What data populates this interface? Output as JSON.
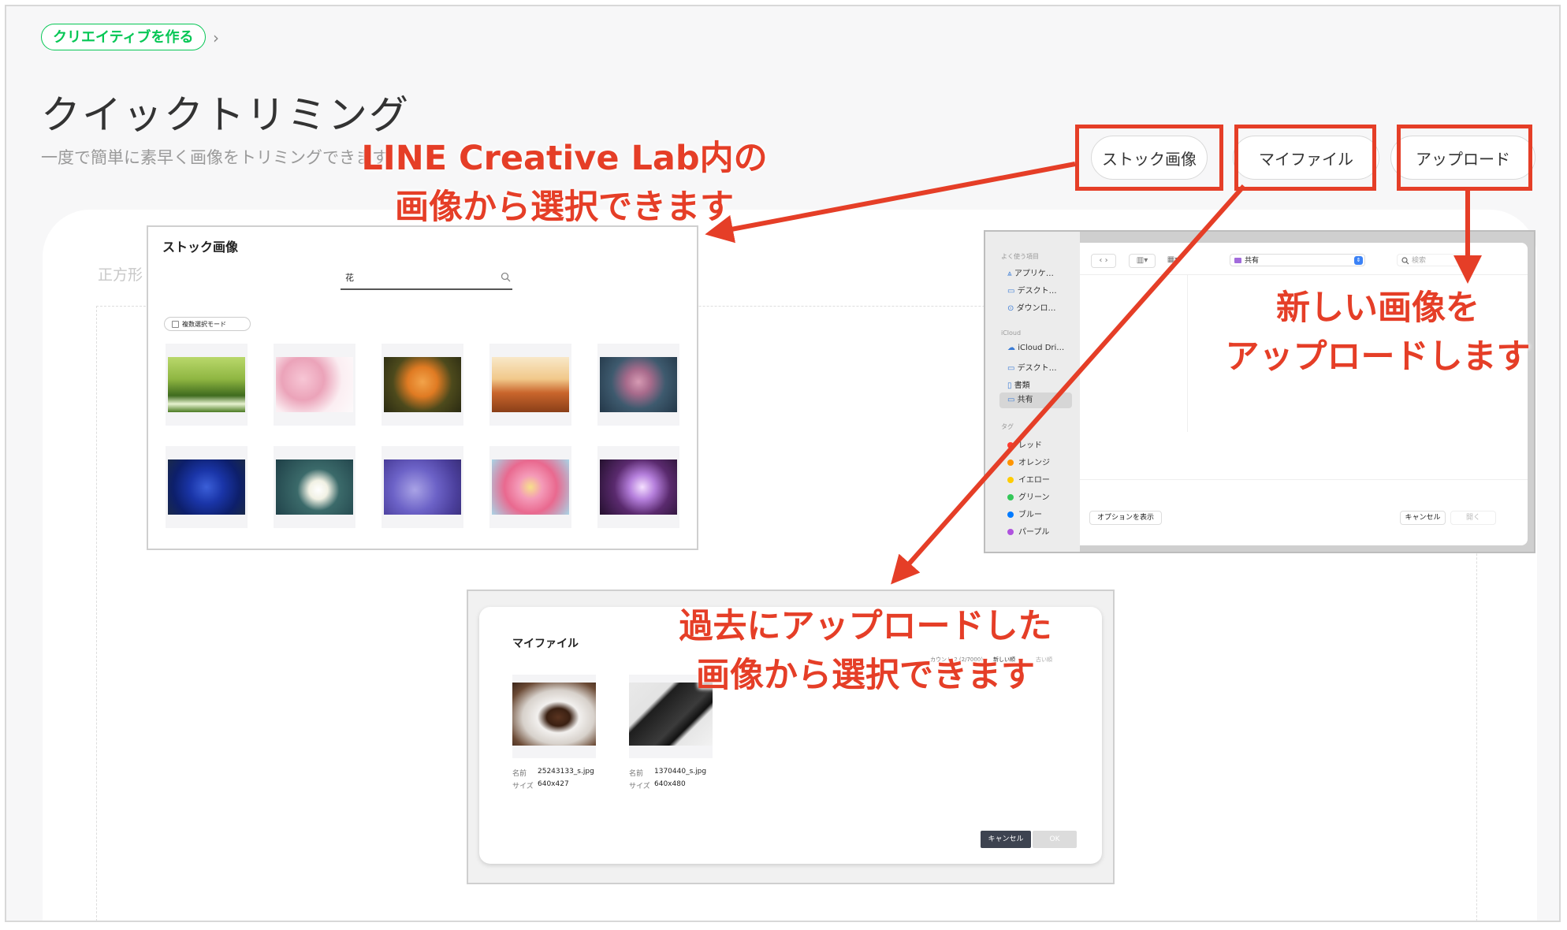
{
  "breadcrumb": {
    "label": "クリエイティブを作る",
    "chevron": "›"
  },
  "page": {
    "title": "クイックトリミング",
    "description": "一度で簡単に素早く画像をトリミングできます",
    "square_label": "正方形"
  },
  "buttons": {
    "stock": "ストック画像",
    "myfile": "マイファイル",
    "upload": "アップロード"
  },
  "callouts": {
    "stock_line1": "LINE Creative Lab内の",
    "stock_line2": "画像から選択できます",
    "upload_line1": "新しい画像を",
    "upload_line2": "アップロードします",
    "myfile_line1": "過去にアップロードした",
    "myfile_line2": "画像から選択できます"
  },
  "stock_dialog": {
    "title": "ストック画像",
    "search_value": "花",
    "multi_select": "複数選択モード",
    "images": [
      "grass-field",
      "cherry-blossom",
      "orange-rose",
      "poppy-field",
      "pink-rose",
      "blue-rose",
      "white-daisy",
      "lotus-purple",
      "pink-gerbera",
      "purple-aster"
    ]
  },
  "finder": {
    "section_favorites": "よく使う項目",
    "favorites": [
      "アプリケ…",
      "デスクト…",
      "ダウンロ…"
    ],
    "section_icloud": "iCloud",
    "icloud": [
      "iCloud Dri…",
      "デスクト…",
      "書類",
      "共有"
    ],
    "section_tags": "タグ",
    "tags": [
      {
        "label": "レッド",
        "color": "#ff3b30"
      },
      {
        "label": "オレンジ",
        "color": "#ff9500"
      },
      {
        "label": "イエロー",
        "color": "#ffcc00"
      },
      {
        "label": "グリーン",
        "color": "#34c759"
      },
      {
        "label": "ブルー",
        "color": "#007aff"
      },
      {
        "label": "パープル",
        "color": "#af52de"
      }
    ],
    "location": "共有",
    "search_placeholder": "検索",
    "options_button": "オプションを表示",
    "cancel_button": "キャンセル",
    "open_button": "開く"
  },
  "myfile_dialog": {
    "title": "マイファイル",
    "count": "カウント 2 (2/7000)",
    "sort_new": "新しい順",
    "sort_old": "古い順",
    "name_label": "名前",
    "size_label": "サイズ",
    "files": [
      {
        "name": "25243133_s.jpg",
        "size": "640x427",
        "image": "coffee-cup"
      },
      {
        "name": "1370440_s.jpg",
        "size": "640x480",
        "image": "black-wallet"
      }
    ],
    "cancel_button": "キャンセル",
    "ok_button": "OK"
  },
  "colors": {
    "accent": "#06c755",
    "callout_red": "#e53e27"
  }
}
